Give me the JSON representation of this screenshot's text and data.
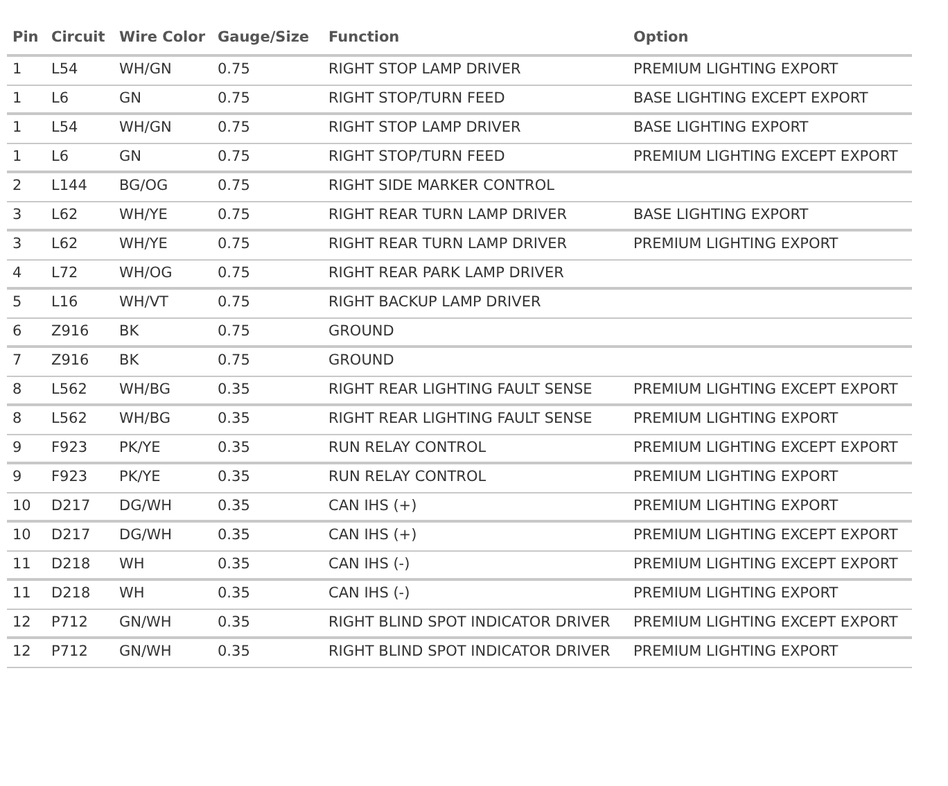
{
  "table": {
    "columns": [
      "Pin",
      "Circuit",
      "Wire Color",
      "Gauge/Size",
      "Function",
      "Option"
    ],
    "rows": [
      [
        "1",
        "L54",
        "WH/GN",
        "0.75",
        "RIGHT STOP LAMP DRIVER",
        "PREMIUM LIGHTING EXPORT"
      ],
      [
        "1",
        "L6",
        "GN",
        "0.75",
        "RIGHT STOP/TURN FEED",
        "BASE LIGHTING EXCEPT EXPORT"
      ],
      [
        "1",
        "L54",
        "WH/GN",
        "0.75",
        "RIGHT STOP LAMP DRIVER",
        "BASE LIGHTING EXPORT"
      ],
      [
        "1",
        "L6",
        "GN",
        "0.75",
        "RIGHT STOP/TURN FEED",
        "PREMIUM LIGHTING EXCEPT EXPORT"
      ],
      [
        "2",
        "L144",
        "BG/OG",
        "0.75",
        "RIGHT SIDE MARKER CONTROL",
        ""
      ],
      [
        "3",
        "L62",
        "WH/YE",
        "0.75",
        "RIGHT REAR TURN LAMP DRIVER",
        "BASE LIGHTING EXPORT"
      ],
      [
        "3",
        "L62",
        "WH/YE",
        "0.75",
        "RIGHT REAR TURN LAMP DRIVER",
        "PREMIUM LIGHTING EXPORT"
      ],
      [
        "4",
        "L72",
        "WH/OG",
        "0.75",
        "RIGHT REAR PARK LAMP DRIVER",
        ""
      ],
      [
        "5",
        "L16",
        "WH/VT",
        "0.75",
        "RIGHT BACKUP LAMP DRIVER",
        ""
      ],
      [
        "6",
        "Z916",
        "BK",
        "0.75",
        "GROUND",
        ""
      ],
      [
        "7",
        "Z916",
        "BK",
        "0.75",
        "GROUND",
        ""
      ],
      [
        "8",
        "L562",
        "WH/BG",
        "0.35",
        "RIGHT REAR LIGHTING FAULT SENSE",
        "PREMIUM LIGHTING EXCEPT EXPORT"
      ],
      [
        "8",
        "L562",
        "WH/BG",
        "0.35",
        "RIGHT REAR LIGHTING FAULT SENSE",
        "PREMIUM LIGHTING EXPORT"
      ],
      [
        "9",
        "F923",
        "PK/YE",
        "0.35",
        "RUN RELAY CONTROL",
        "PREMIUM LIGHTING EXCEPT EXPORT"
      ],
      [
        "9",
        "F923",
        "PK/YE",
        "0.35",
        "RUN RELAY CONTROL",
        "PREMIUM LIGHTING EXPORT"
      ],
      [
        "10",
        "D217",
        "DG/WH",
        "0.35",
        "CAN IHS (+)",
        "PREMIUM LIGHTING EXPORT"
      ],
      [
        "10",
        "D217",
        "DG/WH",
        "0.35",
        "CAN IHS (+)",
        "PREMIUM LIGHTING EXCEPT EXPORT"
      ],
      [
        "11",
        "D218",
        "WH",
        "0.35",
        "CAN IHS (-)",
        "PREMIUM LIGHTING EXCEPT EXPORT"
      ],
      [
        "11",
        "D218",
        "WH",
        "0.35",
        "CAN IHS (-)",
        "PREMIUM LIGHTING EXPORT"
      ],
      [
        "12",
        "P712",
        "GN/WH",
        "0.35",
        "RIGHT BLIND SPOT INDICATOR DRIVER",
        "PREMIUM LIGHTING EXCEPT EXPORT"
      ],
      [
        "12",
        "P712",
        "GN/WH",
        "0.35",
        "RIGHT BLIND SPOT INDICATOR DRIVER",
        "PREMIUM LIGHTING EXPORT"
      ]
    ]
  }
}
